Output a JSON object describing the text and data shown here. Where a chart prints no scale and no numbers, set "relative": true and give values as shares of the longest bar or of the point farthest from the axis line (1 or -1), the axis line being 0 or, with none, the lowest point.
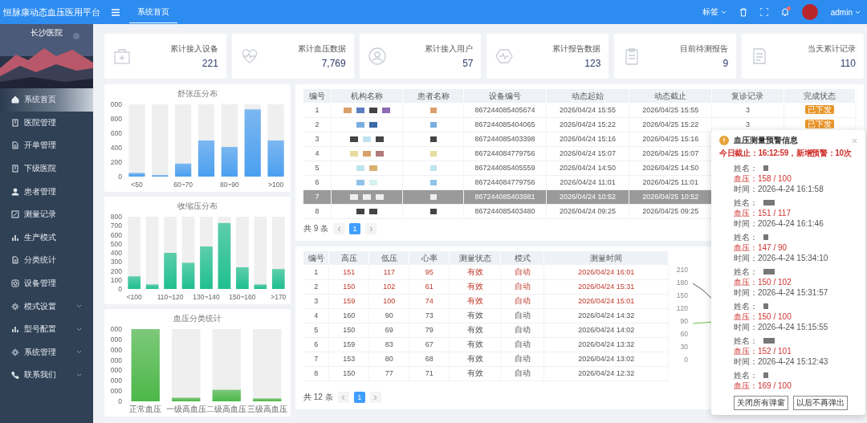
{
  "header": {
    "title": "恒脉康动态血压医用平台",
    "tabs": [
      {
        "label": "系统首页",
        "selected": true
      }
    ],
    "tag_menu": "标签",
    "notification_dot": true,
    "user": "admin"
  },
  "sidebar": {
    "hospital": "长沙医院",
    "items": [
      {
        "label": "系统首页",
        "selected": true,
        "expandable": false
      },
      {
        "label": "医院管理",
        "selected": false,
        "expandable": false
      },
      {
        "label": "开单管理",
        "selected": false,
        "expandable": false
      },
      {
        "label": "下级医院",
        "selected": false,
        "expandable": false
      },
      {
        "label": "患者管理",
        "selected": false,
        "expandable": false
      },
      {
        "label": "测量记录",
        "selected": false,
        "expandable": false
      },
      {
        "label": "生产模式",
        "selected": false,
        "expandable": false
      },
      {
        "label": "分类统计",
        "selected": false,
        "expandable": false
      },
      {
        "label": "设备管理",
        "selected": false,
        "expandable": false
      },
      {
        "label": "模式设置",
        "selected": false,
        "expandable": true
      },
      {
        "label": "型号配置",
        "selected": false,
        "expandable": true
      },
      {
        "label": "系统管理",
        "selected": false,
        "expandable": true
      },
      {
        "label": "联系我们",
        "selected": false,
        "expandable": true
      }
    ]
  },
  "stats": [
    {
      "label": "累计接入设备",
      "value": "221"
    },
    {
      "label": "累计血压数据",
      "value": "7,769"
    },
    {
      "label": "累计接入用户",
      "value": "57"
    },
    {
      "label": "累计报告数据",
      "value": "123"
    },
    {
      "label": "目前待测报告",
      "value": "9"
    },
    {
      "label": "当天累计记录",
      "value": "110"
    }
  ],
  "charts": [
    {
      "chart_data": {
        "type": "bar",
        "title": "舒张压分布",
        "categories": [
          "<50",
          null,
          "60~70",
          null,
          "80~90",
          null,
          ">100"
        ],
        "ylim": [
          0,
          1000
        ],
        "yticks": [
          0,
          200,
          400,
          600,
          800
        ],
        "series": [
          {
            "color": "#4a9ff0",
            "values": [
              50,
              20,
              180,
              500,
              410,
              930,
              500
            ]
          }
        ]
      },
      "cut_axis_labels": [
        "000"
      ]
    },
    {
      "chart_data": {
        "type": "bar",
        "title": "收缩压分布",
        "categories": [
          "<100",
          null,
          "110~120",
          null,
          "130~140",
          null,
          "150~160",
          null,
          ">170"
        ],
        "ylim": [
          0,
          800
        ],
        "yticks": [
          0,
          100,
          200,
          300,
          400,
          500,
          600,
          700,
          800
        ],
        "series": [
          {
            "color": "#1fbf8f",
            "values": [
              140,
              50,
              400,
              290,
              470,
              730,
              240,
              50,
              220
            ]
          }
        ]
      }
    },
    {
      "chart_data": {
        "type": "bar",
        "title": "血压分类统计",
        "relative": true,
        "categories": [
          "正常血压",
          "一级高血压",
          "二级高血压",
          "三级高血压"
        ],
        "series": [
          {
            "color": "#4cb848",
            "values": [
              1,
              0.05,
              0.16,
              0.04
            ]
          }
        ]
      },
      "cut_axis_labels": [
        "000",
        "000",
        "000",
        "000",
        "000",
        "000",
        "000",
        "0"
      ]
    }
  ],
  "device_table": {
    "columns": [
      "编号",
      "机构名称",
      "患者名称",
      "设备编号",
      "动态起始",
      "动态截止",
      "复诊记录",
      "完成状态"
    ],
    "rows": [
      {
        "cells": [
          "1",
          "",
          "",
          "867244085405674",
          "2026/04/24 15:55",
          "2026/04/25 15:55",
          "3"
        ],
        "status": "已下发",
        "selected": false
      },
      {
        "cells": [
          "2",
          "",
          "",
          "867244085404065",
          "2026/04/24 15:22",
          "2026/04/25 15:22",
          "3"
        ],
        "status": "已下发",
        "selected": false
      },
      {
        "cells": [
          "3",
          "",
          "",
          "867244085403398",
          "2026/04/24 15:16",
          "2026/04/25 15:16"
        ],
        "selected": false
      },
      {
        "cells": [
          "4",
          "",
          "",
          "867244084779756",
          "2026/04/24 15:07",
          "2026/04/25 15:07"
        ],
        "selected": false
      },
      {
        "cells": [
          "5",
          "",
          "",
          "867244085405559",
          "2026/04/24 14:50",
          "2026/04/25 14:50"
        ],
        "selected": false
      },
      {
        "cells": [
          "6",
          "",
          "",
          "867244084779756",
          "2026/04/24 11:01",
          "2026/04/25 11:01"
        ],
        "selected": false
      },
      {
        "cells": [
          "7",
          "",
          "",
          "867244085403981",
          "2026/04/24 10:52",
          "2026/04/25 10:52"
        ],
        "selected": true
      },
      {
        "cells": [
          "8",
          "",
          "",
          "867244085403480",
          "2026/04/24 09:25",
          "2026/04/25 09:25"
        ],
        "selected": false
      }
    ],
    "total": "共 9 条",
    "page": "1"
  },
  "record_table": {
    "columns": [
      "编号",
      "高压",
      "低压",
      "心率",
      "测量状态",
      "模式",
      "测量时间"
    ],
    "rows": [
      {
        "cells": [
          "1",
          "151",
          "117",
          "95",
          "有效",
          "自动",
          "2026/04/24 16:01"
        ],
        "abnormal": true
      },
      {
        "cells": [
          "2",
          "150",
          "102",
          "61",
          "有效",
          "自动",
          "2026/04/24 15:31"
        ],
        "abnormal": true
      },
      {
        "cells": [
          "3",
          "159",
          "100",
          "74",
          "有效",
          "自动",
          "2026/04/24 15:01"
        ],
        "abnormal": true
      },
      {
        "cells": [
          "4",
          "160",
          "90",
          "73",
          "有效",
          "自动",
          "2026/04/24 14:32"
        ],
        "abnormal": false
      },
      {
        "cells": [
          "5",
          "150",
          "69",
          "79",
          "有效",
          "自动",
          "2026/04/24 14:02"
        ],
        "abnormal": false
      },
      {
        "cells": [
          "6",
          "159",
          "83",
          "67",
          "有效",
          "自动",
          "2026/04/24 13:32"
        ],
        "abnormal": false
      },
      {
        "cells": [
          "7",
          "153",
          "80",
          "68",
          "有效",
          "自动",
          "2026/04/24 13:02"
        ],
        "abnormal": false
      },
      {
        "cells": [
          "8",
          "150",
          "77",
          "71",
          "有效",
          "自动",
          "2026/04/24 12:32"
        ],
        "abnormal": false
      }
    ],
    "total": "共 12 条",
    "page": "1"
  },
  "trend_chart": {
    "yticks": [
      "210",
      "180",
      "150",
      "120",
      "90",
      "60",
      "30",
      "0"
    ]
  },
  "alert_panel": {
    "title": "血压测量预警信息",
    "summary": "今日截止：16:12:59，新增预警：10次",
    "entries": [
      {
        "name_label": "姓名：",
        "pressure": "血压：158 / 100",
        "time": "时间：2026-4-24 16:1:58"
      },
      {
        "name_label": "姓名：",
        "pressure": "血压：151 / 117",
        "time": "时间：2026-4-24 16:1:46"
      },
      {
        "name_label": "姓名：",
        "pressure": "血压：147 / 90",
        "time": "时间：2026-4-24 15:34:10"
      },
      {
        "name_label": "姓名：",
        "pressure": "血压：150 / 102",
        "time": "时间：2026-4-24 15:31:57"
      },
      {
        "name_label": "姓名：",
        "pressure": "血压：150 / 100",
        "time": "时间：2026-4-24 15:15:55"
      },
      {
        "name_label": "姓名：",
        "pressure": "血压：152 / 101",
        "time": "时间：2026-4-24 15:12:43"
      },
      {
        "name_label": "姓名：",
        "pressure": "血压：169 / 100"
      }
    ],
    "buttons": [
      "关闭所有弹窗",
      "以后不再弹出"
    ]
  }
}
